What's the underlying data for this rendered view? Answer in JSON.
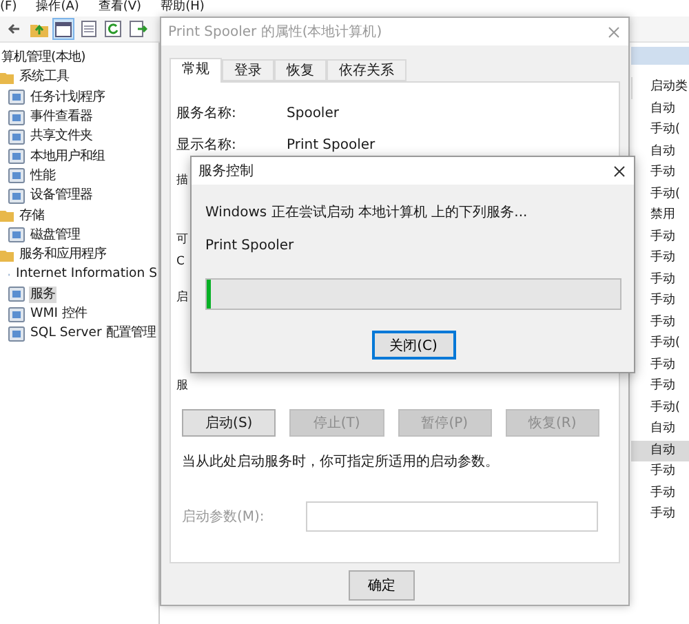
{
  "menu": [
    "(F)",
    "操作(A)",
    "查看(V)",
    "帮助(H)"
  ],
  "tree": {
    "label": "算机管理(本地)",
    "selected": false,
    "children": [
      {
        "label": "系统工具",
        "selected": false,
        "children": [
          {
            "label": "任务计划程序",
            "selected": false
          },
          {
            "label": "事件查看器",
            "selected": false
          },
          {
            "label": "共享文件夹",
            "selected": false
          },
          {
            "label": "本地用户和组",
            "selected": false
          },
          {
            "label": "性能",
            "selected": false
          },
          {
            "label": "设备管理器",
            "selected": false
          }
        ]
      },
      {
        "label": "存储",
        "selected": false,
        "children": [
          {
            "label": "磁盘管理",
            "selected": false
          }
        ]
      },
      {
        "label": "服务和应用程序",
        "selected": false,
        "children": [
          {
            "label": "Internet Information S",
            "selected": false
          },
          {
            "label": "服务",
            "selected": true
          },
          {
            "label": "WMI 控件",
            "selected": false
          },
          {
            "label": "SQL Server 配置管理",
            "selected": false
          }
        ]
      }
    ]
  },
  "services_list": {
    "header": "启动类",
    "rows": [
      {
        "startup": "自动",
        "selected": false
      },
      {
        "startup": "手动(",
        "selected": false
      },
      {
        "startup": "自动",
        "selected": false
      },
      {
        "startup": "手动",
        "selected": false
      },
      {
        "startup": "手动(",
        "selected": false
      },
      {
        "startup": "禁用",
        "selected": false
      },
      {
        "startup": "手动",
        "selected": false
      },
      {
        "startup": "手动",
        "selected": false
      },
      {
        "startup": "手动",
        "selected": false
      },
      {
        "startup": "手动",
        "selected": false
      },
      {
        "startup": "手动",
        "selected": false
      },
      {
        "startup": "手动(",
        "selected": false
      },
      {
        "startup": "手动",
        "selected": false
      },
      {
        "startup": "手动",
        "selected": false
      },
      {
        "startup": "手动(",
        "selected": false
      },
      {
        "startup": "自动",
        "selected": false
      },
      {
        "startup": "自动",
        "selected": true
      },
      {
        "startup": "手动",
        "selected": false
      },
      {
        "startup": "手动",
        "selected": false
      },
      {
        "startup": "手动",
        "selected": false
      }
    ]
  },
  "properties_window": {
    "title": "Print Spooler 的属性(本地计算机)",
    "tabs": [
      {
        "label": "常规",
        "selected": true
      },
      {
        "label": "登录",
        "selected": false
      },
      {
        "label": "恢复",
        "selected": false
      },
      {
        "label": "依存关系",
        "selected": false
      }
    ],
    "fields": [
      {
        "label": "服务名称:",
        "value": "Spooler"
      },
      {
        "label": "显示名称:",
        "value": "Print Spooler"
      }
    ],
    "cut_labels": [
      "描",
      "可",
      "C",
      "启",
      "服"
    ],
    "service_buttons": [
      {
        "label": "启动(S)",
        "disabled": false
      },
      {
        "label": "停止(T)",
        "disabled": true
      },
      {
        "label": "暂停(P)",
        "disabled": true
      },
      {
        "label": "恢复(R)",
        "disabled": true
      }
    ],
    "hint": "当从此处启动服务时，你可指定所适用的启动参数。",
    "start_params": {
      "label": "启动参数(M):",
      "disabled": true
    },
    "ok_button": "确定"
  },
  "service_control_dialog": {
    "title": "服务控制",
    "message": "Windows 正在尝试启动 本地计算机 上的下列服务...",
    "service": "Print Spooler",
    "progress": {
      "level": 0.01
    },
    "close_button": {
      "label": "关闭(C)",
      "focused": true
    }
  }
}
